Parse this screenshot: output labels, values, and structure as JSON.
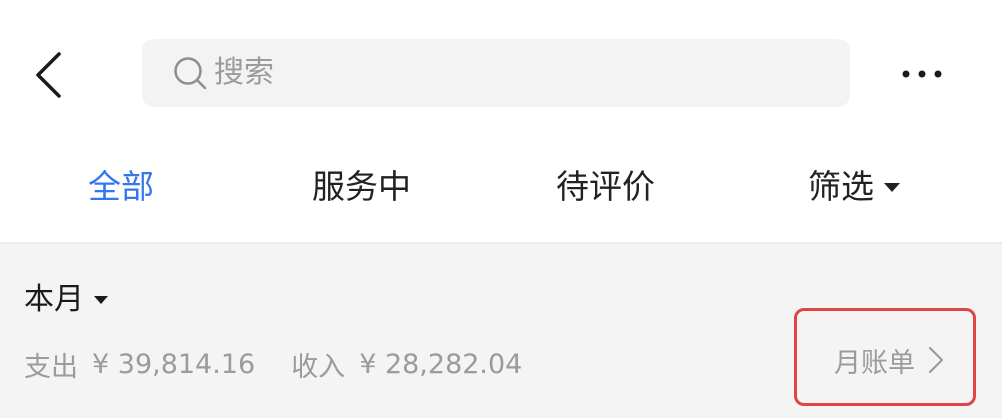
{
  "header": {
    "back_icon": "chevron-left-icon",
    "search": {
      "icon": "search-icon",
      "placeholder": "搜索"
    },
    "more_icon": "more-dots-icon"
  },
  "tabs": [
    {
      "label": "全部",
      "active": true
    },
    {
      "label": "服务中",
      "active": false
    },
    {
      "label": "待评价",
      "active": false
    },
    {
      "label": "筛选",
      "active": false,
      "has_dropdown": true
    }
  ],
  "summary": {
    "month_label": "本月",
    "expense_label": "支出",
    "expense_value": "¥ 39,814.16",
    "income_label": "收入",
    "income_value": "¥ 28,282.04",
    "monthly_bill_label": "月账单"
  },
  "colors": {
    "accent": "#3377ee",
    "highlight_border": "#e04545",
    "muted_text": "#9b9b9b",
    "summary_bg": "#f4f4f4"
  }
}
